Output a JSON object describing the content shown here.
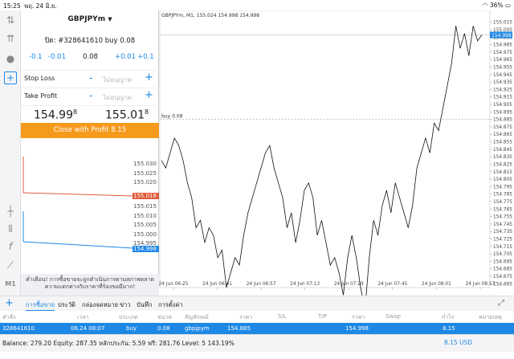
{
  "status": {
    "time": "15:25",
    "date": "พฤ. 24 มิ.ย.",
    "battery": "36%"
  },
  "panel": {
    "symbol": "GBPJPYm",
    "close_title": "ปิด: #328641610 buy 0.08",
    "steps": [
      "-0.1",
      "-0.01",
      "0.08",
      "+0.01",
      "+0.1"
    ],
    "stop_loss": {
      "label": "Stop Loss",
      "value": "ไม่อนุญาต"
    },
    "take_profit": {
      "label": "Take Profit",
      "value": "ไม่อนุญาต"
    },
    "bid": {
      "main": "154.99",
      "sup": "8"
    },
    "ask": {
      "main": "155.01",
      "sup": "8"
    },
    "close_button": "Close with Profit 8.15",
    "mini_ask_ticks": [
      "155.030",
      "155.025",
      "155.020"
    ],
    "mini_ask_tag": "155.018",
    "mini_bid_ticks": [
      "155.015",
      "155.010",
      "155.005",
      "155.000",
      "154.995"
    ],
    "mini_bid_tag": "154.998",
    "warning": "คำเตือน! การซื้อขายจะถูกดำเนินการตามสภาพตลาด ความแตกต่างกับราคาที่ร้องขอมีมาก!"
  },
  "chart_data": {
    "type": "line",
    "title": "GBPJPYm, M1, 155.024 154.998 154.998",
    "x_ticks": [
      "24 Jun 06:25",
      "24 Jun 06:41",
      "24 Jun 06:57",
      "24 Jun 07:13",
      "24 Jun 07:29",
      "24 Jun 07:45",
      "24 Jun 08:01",
      "24 Jun 08:17"
    ],
    "y_ticks": [
      "155.015",
      "155.005",
      "154.995",
      "154.985",
      "154.975",
      "154.965",
      "154.955",
      "154.945",
      "154.935",
      "154.925",
      "154.915",
      "154.905",
      "154.895",
      "154.885",
      "154.875",
      "154.865",
      "154.855",
      "154.845",
      "154.835",
      "154.825",
      "154.815",
      "154.805",
      "154.795",
      "154.785",
      "154.775",
      "154.765",
      "154.755",
      "154.745",
      "154.735",
      "154.725",
      "154.715",
      "154.705",
      "154.695",
      "154.685",
      "154.675",
      "154.665"
    ],
    "ylim": [
      154.66,
      155.02
    ],
    "price_tag": "154.998",
    "entry_label": "buy 0.08",
    "entry_price": 154.885,
    "current_price": 154.998,
    "series": [
      {
        "values": [
          154.83,
          154.82,
          154.84,
          154.86,
          154.85,
          154.83,
          154.8,
          154.78,
          154.74,
          154.75,
          154.72,
          154.74,
          154.73,
          154.7,
          154.71,
          154.66,
          154.68,
          154.7,
          154.69,
          154.73,
          154.76,
          154.78,
          154.8,
          154.82,
          154.84,
          154.85,
          154.82,
          154.8,
          154.78,
          154.74,
          154.76,
          154.72,
          154.75,
          154.79,
          154.8,
          154.78,
          154.73,
          154.75,
          154.72,
          154.69,
          154.7,
          154.68,
          154.65,
          154.7,
          154.73,
          154.7,
          154.66,
          154.63,
          154.7,
          154.75,
          154.73,
          154.77,
          154.79,
          154.76,
          154.8,
          154.78,
          154.76,
          154.74,
          154.77,
          154.82,
          154.84,
          154.86,
          154.84,
          154.88,
          154.87,
          154.9,
          154.93,
          154.96,
          155.01,
          154.98,
          155.0,
          154.97,
          155.01,
          154.99,
          154.998
        ]
      }
    ]
  },
  "bottom_tabs": [
    "การซื้อขาย",
    "ประวัติ",
    "กล่องจดหมาย",
    "ข่าว",
    "บันทึก",
    "การตั้งค่า"
  ],
  "columns": [
    "คำสั่ง",
    "เวลา",
    "ประเภท",
    "ขนาด",
    "สัญลักษณ์",
    "ราคา",
    "S/L",
    "T/P",
    "ราคา",
    "Swap",
    "กำไร",
    "หมายเหตุ"
  ],
  "trade_row": [
    "328641610",
    "06.24 08:07",
    "buy",
    "0.08",
    "gbpjpym",
    "154.885",
    "",
    "",
    "154.998",
    "",
    "8.15",
    ""
  ],
  "balance_text": "Balance: 279.20 Equity: 287.35 หลักประกัน: 5.59 ฟรี: 281.76 Level: 5 143.19%",
  "profit_total": "8.15",
  "currency": "USD",
  "colors": {
    "accent": "#1e88e5",
    "button": "#f59a1c",
    "ask_line": "#e05a3c",
    "bid_line": "#1e88e5"
  }
}
